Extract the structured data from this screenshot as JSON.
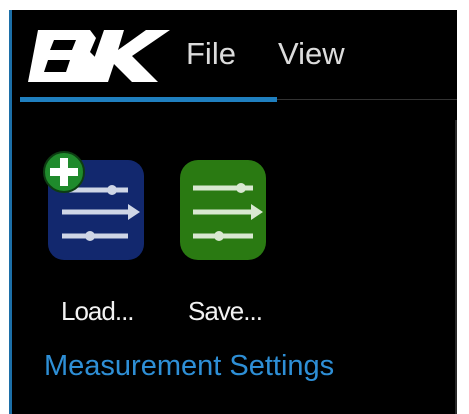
{
  "app": {
    "logo_text": "BK"
  },
  "menu": {
    "items": [
      {
        "label": "File"
      },
      {
        "label": "View"
      }
    ]
  },
  "ribbon": {
    "group_title": "Measurement Settings",
    "buttons": [
      {
        "label": "Load..."
      },
      {
        "label": "Save..."
      }
    ]
  },
  "colors": {
    "accent": "#1f7fbf",
    "group_title": "#2e8fd6",
    "load_icon_bg": "#12286e",
    "save_icon_bg": "#2a7a12",
    "plus_badge": "#1f8a2c"
  },
  "icons": {
    "logo": "bk-logo",
    "load": "load-settings-icon",
    "save": "save-settings-icon"
  }
}
